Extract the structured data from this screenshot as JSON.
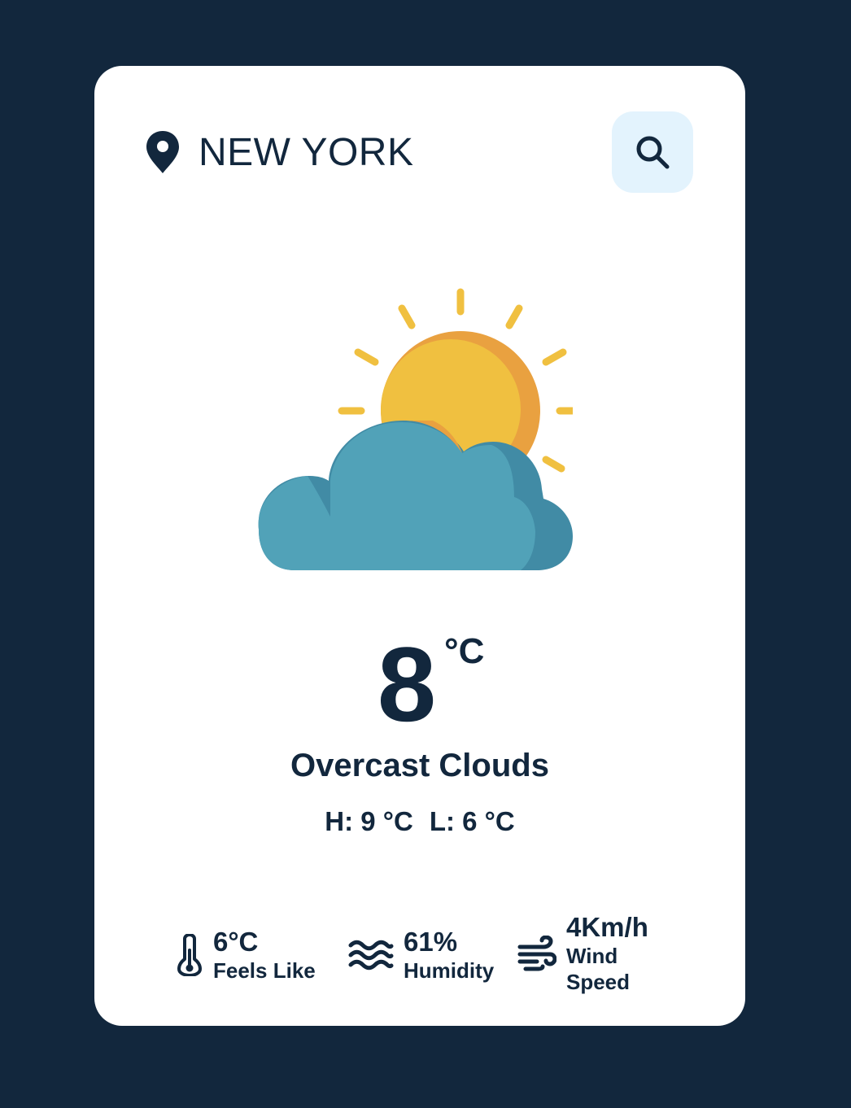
{
  "location": {
    "icon": "map-pin-icon",
    "city": "NEW YORK"
  },
  "search": {
    "icon": "search-icon"
  },
  "weather": {
    "icon": "partly-cloudy-icon",
    "temperature": "8",
    "unit": "°C",
    "description": "Overcast Clouds",
    "high": "H: 9 °C",
    "low": "L: 6 °C"
  },
  "stats": {
    "feels_like": {
      "icon": "thermometer-icon",
      "value": "6°C",
      "label": "Feels Like"
    },
    "humidity": {
      "icon": "waves-icon",
      "value": "61%",
      "label": "Humidity"
    },
    "wind": {
      "icon": "wind-icon",
      "value": "4Km/h",
      "label": "Wind Speed"
    }
  },
  "colors": {
    "background": "#12273d",
    "card": "#ffffff",
    "search_button_bg": "#e3f3fd",
    "sun": "#f0c040",
    "sun_shade": "#e9a140",
    "cloud": "#51a2b8",
    "cloud_shade": "#418ba5"
  }
}
